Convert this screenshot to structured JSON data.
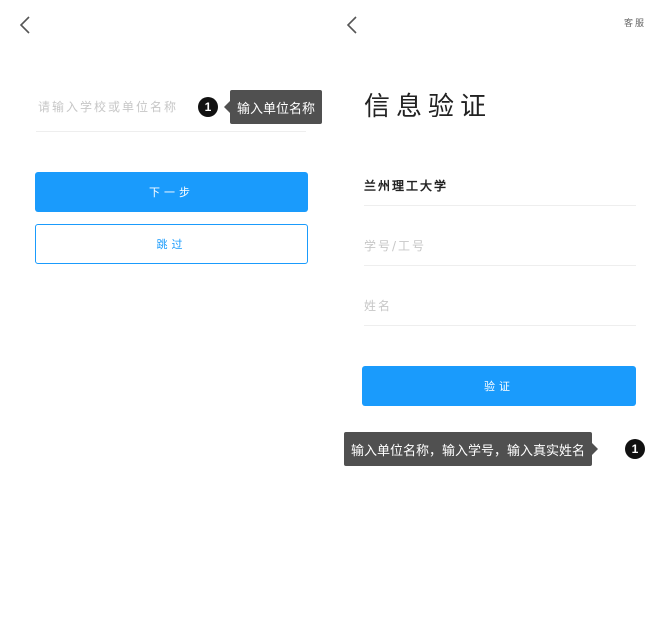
{
  "left_screen": {
    "school_input": {
      "placeholder": "请输入学校或单位名称"
    },
    "next_button": "下一步",
    "skip_button": "跳过"
  },
  "right_screen": {
    "service_link": "客服",
    "title": "信息验证",
    "school_field": {
      "value": "兰州理工大学"
    },
    "id_field": {
      "placeholder": "学号/工号"
    },
    "name_field": {
      "placeholder": "姓名"
    },
    "verify_button": "验证"
  },
  "annotations": {
    "callout_1": {
      "number": "1",
      "text": "输入单位名称"
    },
    "callout_2": {
      "number": "1",
      "text": "输入单位名称，输入学号，输入真实姓名"
    }
  },
  "colors": {
    "accent": "#1a9bfc",
    "tooltip_bg": "#505050"
  }
}
